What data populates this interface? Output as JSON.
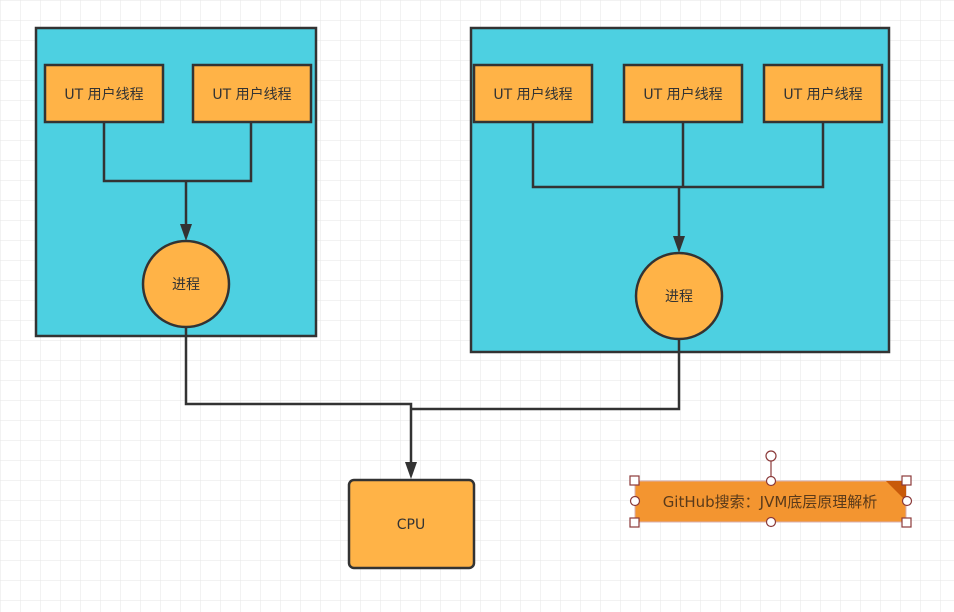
{
  "colors": {
    "container": "#4dd0e1",
    "node": "#ffb347",
    "stroke": "#333333",
    "note": "#f39530",
    "note_fold": "#c85a0a",
    "handle": "#8b3a3a"
  },
  "left_group": {
    "threads": [
      "UT 用户线程",
      "UT 用户线程"
    ],
    "process": "进程"
  },
  "right_group": {
    "threads": [
      "UT 用户线程",
      "UT 用户线程",
      "UT 用户线程"
    ],
    "process": "进程"
  },
  "cpu": "CPU",
  "note": {
    "text": "GitHub搜索：JVM底层原理解析",
    "selected": true
  }
}
